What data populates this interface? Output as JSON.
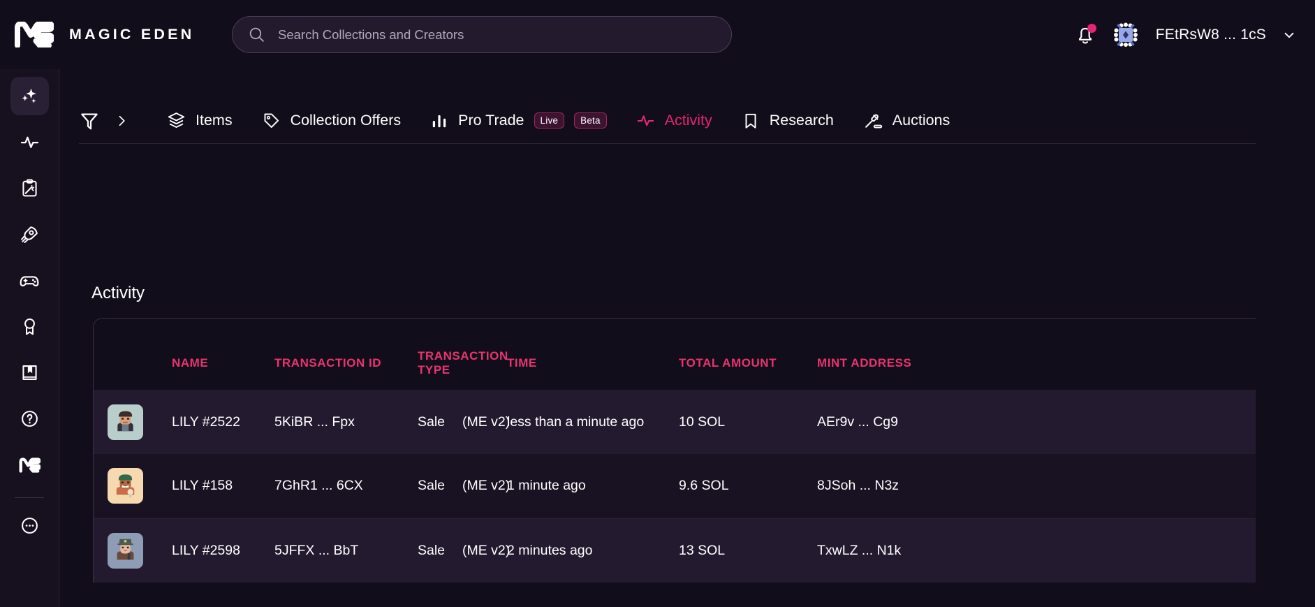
{
  "brand": {
    "name": "MAGIC EDEN",
    "logo_icon": "magic-eden-logo"
  },
  "search": {
    "placeholder": "Search Collections and Creators",
    "value": "",
    "icon": "search-icon"
  },
  "header": {
    "notification_icon": "bell-icon",
    "has_unread": true,
    "wallet_label": "FEtRsW8 ... 1cS",
    "wallet_avatar_icon": "wallet-avatar-icon",
    "chevron_icon": "chevron-down-icon"
  },
  "sidebar": {
    "items": [
      {
        "icon": "sparkles-icon",
        "active": true
      },
      {
        "icon": "activity-pulse-icon",
        "active": false
      },
      {
        "icon": "clipboard-wand-icon",
        "active": false
      },
      {
        "icon": "rocket-icon",
        "active": false
      },
      {
        "icon": "gamepad-icon",
        "active": false
      },
      {
        "icon": "award-ribbon-icon",
        "active": false
      },
      {
        "icon": "book-bookmark-icon",
        "active": false
      },
      {
        "icon": "help-circle-icon",
        "active": false
      },
      {
        "icon": "magic-eden-mark-icon",
        "active": false
      }
    ],
    "footer_icon": "more-dots-icon"
  },
  "tabs": {
    "filter_icon": "filter-icon",
    "expand_icon": "chevron-right-icon",
    "items": [
      {
        "label": "Items",
        "icon": "layers-icon",
        "active": false
      },
      {
        "label": "Collection Offers",
        "icon": "tag-icon",
        "active": false
      },
      {
        "label": "Pro Trade",
        "icon": "bar-chart-icon",
        "active": false,
        "badges": [
          "Live",
          "Beta"
        ]
      },
      {
        "label": "Activity",
        "icon": "activity-pulse-icon",
        "active": true
      },
      {
        "label": "Research",
        "icon": "bookmark-icon",
        "active": false
      },
      {
        "label": "Auctions",
        "icon": "gavel-icon",
        "active": false
      }
    ]
  },
  "activity": {
    "title": "Activity",
    "columns": [
      "NAME",
      "TRANSACTION ID",
      "TRANSACTION TYPE",
      "TIME",
      "TOTAL AMOUNT",
      "MINT ADDRESS"
    ],
    "rows": [
      {
        "name": "LILY #2522",
        "transaction_id": "5KiBR ... Fpx",
        "transaction_type": "Sale",
        "marketplace": "(ME v2)",
        "time": "less than a minute ago",
        "total_amount": "10 SOL",
        "mint_address": "AEr9v ... Cg9",
        "thumb_bg": "#b9cdcb",
        "thumb_accent": "#3b2c29",
        "thumb_skin": "#d9a07c"
      },
      {
        "name": "LILY #158",
        "transaction_id": "7GhR1 ... 6CX",
        "transaction_type": "Sale",
        "marketplace": "(ME v2)",
        "time": "1 minute ago",
        "total_amount": "9.6 SOL",
        "mint_address": "8JSoh ... N3z",
        "thumb_bg": "#f7d9b0",
        "thumb_accent": "#2f6b4a",
        "thumb_skin": "#b06a42"
      },
      {
        "name": "LILY #2598",
        "transaction_id": "5JFFX ... BbT",
        "transaction_type": "Sale",
        "marketplace": "(ME v2)",
        "time": "2 minutes ago",
        "total_amount": "13 SOL",
        "mint_address": "TxwLZ ... N1k",
        "thumb_bg": "#8f9cb5",
        "thumb_accent": "#4a5a4f",
        "thumb_skin": "#e8b9a0"
      }
    ]
  },
  "colors": {
    "background": "#120d1a",
    "panel": "#191222",
    "accent_pink": "#e42575",
    "header_pink": "#e8356f",
    "sale_green": "#1ec27e",
    "row_alt": "#241a30"
  }
}
